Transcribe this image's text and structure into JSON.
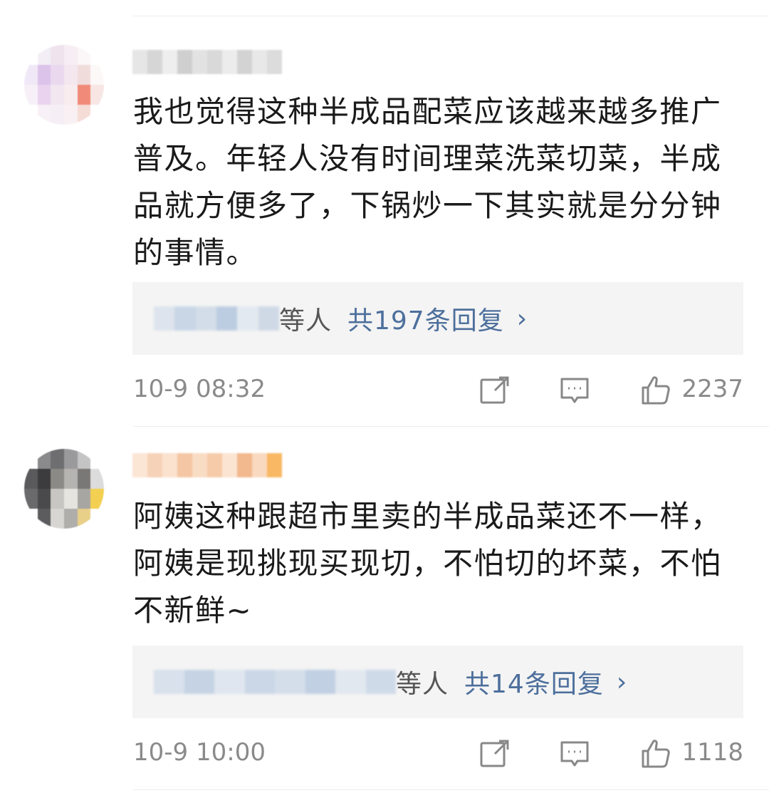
{
  "comments": [
    {
      "text_lines": [
        "我也觉得这种半成品配菜应该越来越多推广",
        "普及。年轻人没有时间理菜洗菜切菜，半成",
        "品就方便多了，下锅炒一下其实就是分分钟",
        "的事情。"
      ],
      "replies": {
        "etc": "等人",
        "count": "共197条回复"
      },
      "time": "10-9 08:32",
      "likes": "2237",
      "avatar_colors": [
        "#ffffff",
        "#f3eef6",
        "#efe4ee",
        "#f6eef2",
        "#fbf6f8",
        "#ffffff",
        "#f0e8f6",
        "#dcc3ea",
        "#ead9ee",
        "#f4e7ee",
        "#f1dcdc",
        "#fdf8f8",
        "#f7f0f8",
        "#e9d3ef",
        "#f2e6f1",
        "#f8ecee",
        "#f18a78",
        "#f7e6e4",
        "#ffffff",
        "#f7f0f6",
        "#f6eef5",
        "#f8f0f2",
        "#f6dcd7",
        "#ffffff"
      ],
      "username_colors": [
        "#e6e6e6",
        "#d6d6d6",
        "#eeeeee",
        "#cfcfcf",
        "#e2e2e2",
        "#d9d9d9",
        "#ececec",
        "#d3d3d3",
        "#e8e8e8",
        "#dcdcdc"
      ],
      "reply_user_colors": [
        "#dde4ed",
        "#c8d6e6",
        "#d3dde9",
        "#bccde1",
        "#e3e9f1",
        "#cfd9e6"
      ]
    },
    {
      "text_lines": [
        "阿姨这种跟超市里卖的半成品菜还不一样，",
        "阿姨是现挑现买现切，不怕切的坏菜，不怕",
        "不新鲜~"
      ],
      "replies": {
        "etc": "等人",
        "count": "共14条回复"
      },
      "time": "10-9 10:00",
      "likes": "1118",
      "avatar_colors": [
        "#ffffff",
        "#8a8a8c",
        "#6e6e70",
        "#9a9a9c",
        "#c4c4c4",
        "#ffffff",
        "#5a5a5c",
        "#3c3c3e",
        "#8c8a86",
        "#b6b4b0",
        "#7a7876",
        "#dcdcdc",
        "#6a6a6c",
        "#4a4a4c",
        "#c8c6c2",
        "#e6e4df",
        "#a8a6a2",
        "#f3cf52",
        "#ffffff",
        "#5c5c5e",
        "#d8d6d2",
        "#b0aeaa",
        "#e8d088",
        "#ffffff"
      ],
      "username_colors": [
        "#fbe6d6",
        "#f6d2b8",
        "#fbe2cf",
        "#f4c6a4",
        "#f9dcc4",
        "#f6cba9",
        "#fbe4d2",
        "#f2b88e",
        "#f9d9bf",
        "#f8b864"
      ],
      "reply_user_colors": [
        "#d8e1ec",
        "#c5d3e4",
        "#dfe6ef",
        "#cbd7e6",
        "#d4deea",
        "#c1d0e2",
        "#e2e8f0",
        "#cfdae8"
      ]
    }
  ],
  "icons": {
    "share": "share-icon",
    "comment": "comment-icon",
    "like": "thumbs-up-icon"
  },
  "colors": {
    "link": "#4d6f9c",
    "meta": "#8a8a8a",
    "reply_bg": "#f4f4f4"
  }
}
